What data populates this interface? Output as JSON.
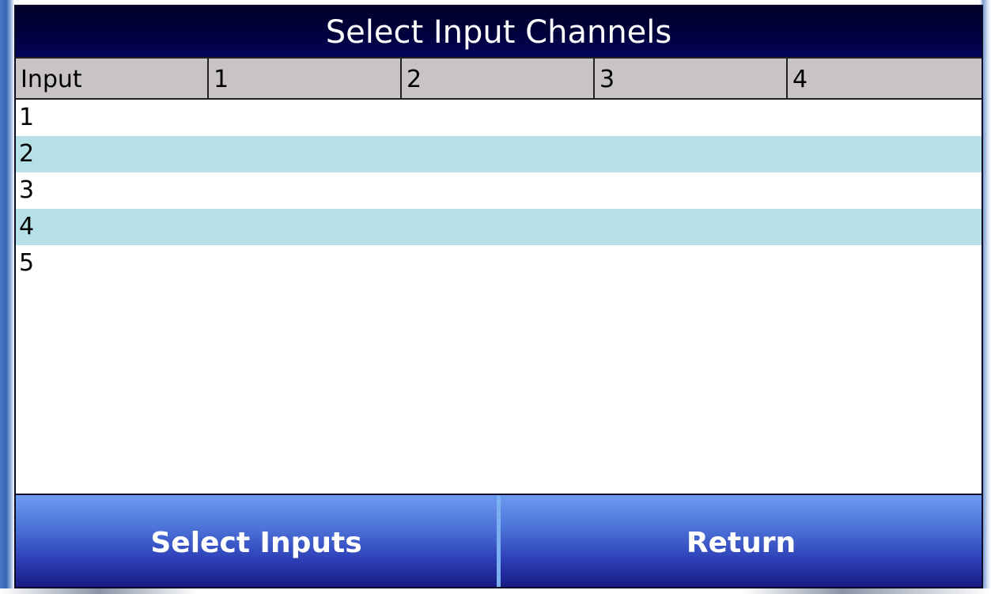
{
  "window": {
    "title": "Select Input Channels"
  },
  "table": {
    "headers": [
      "Input",
      "1",
      "2",
      "3",
      "4"
    ],
    "rows": [
      "1",
      "2",
      "3",
      "4",
      "5"
    ]
  },
  "buttons": {
    "select_inputs_label": "Select Inputs",
    "return_label": "Return"
  },
  "colors": {
    "title_bar": "#000028",
    "header_bg": "#c8c4c6",
    "alt_row": "#b4e0e6",
    "button_gradient_top": "#6e9af0",
    "button_gradient_bottom": "#16187e"
  }
}
